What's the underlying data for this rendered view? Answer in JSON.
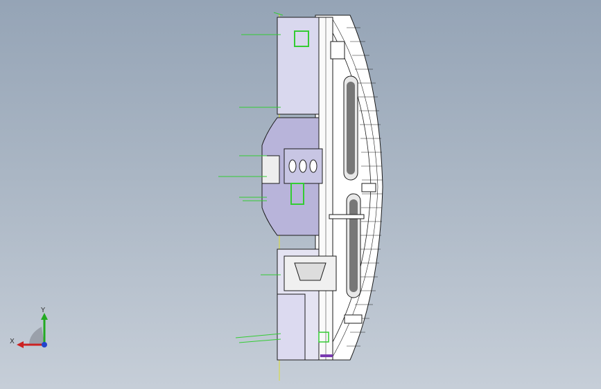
{
  "viewport": {
    "background_top": "#95a4b6",
    "background_bottom": "#c6ced8"
  },
  "triad": {
    "x_label": "X",
    "y_label": "Y",
    "x_color": "#cc2222",
    "y_color": "#22aa22",
    "z_color": "#2244cc"
  },
  "model": {
    "edge_color": "#1a1a1a",
    "face_color": "#ffffff",
    "purple_face": "#b8b4da",
    "leader_color": "#33cc33",
    "highlight_color": "#dddd33"
  }
}
